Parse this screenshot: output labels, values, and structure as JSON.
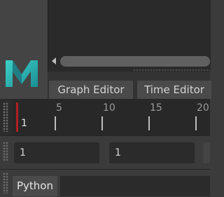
{
  "tabs": {
    "graph_editor": "Graph Editor",
    "time_editor": "Time Editor"
  },
  "timeline": {
    "ticks": [
      "5",
      "10",
      "15",
      "20"
    ],
    "current_frame": "1"
  },
  "range": {
    "start": "1",
    "end": "1"
  },
  "script": {
    "language": "Python",
    "input": ""
  },
  "colors": {
    "logo_teal": "#2fb7b4",
    "playhead": "#b02020"
  }
}
